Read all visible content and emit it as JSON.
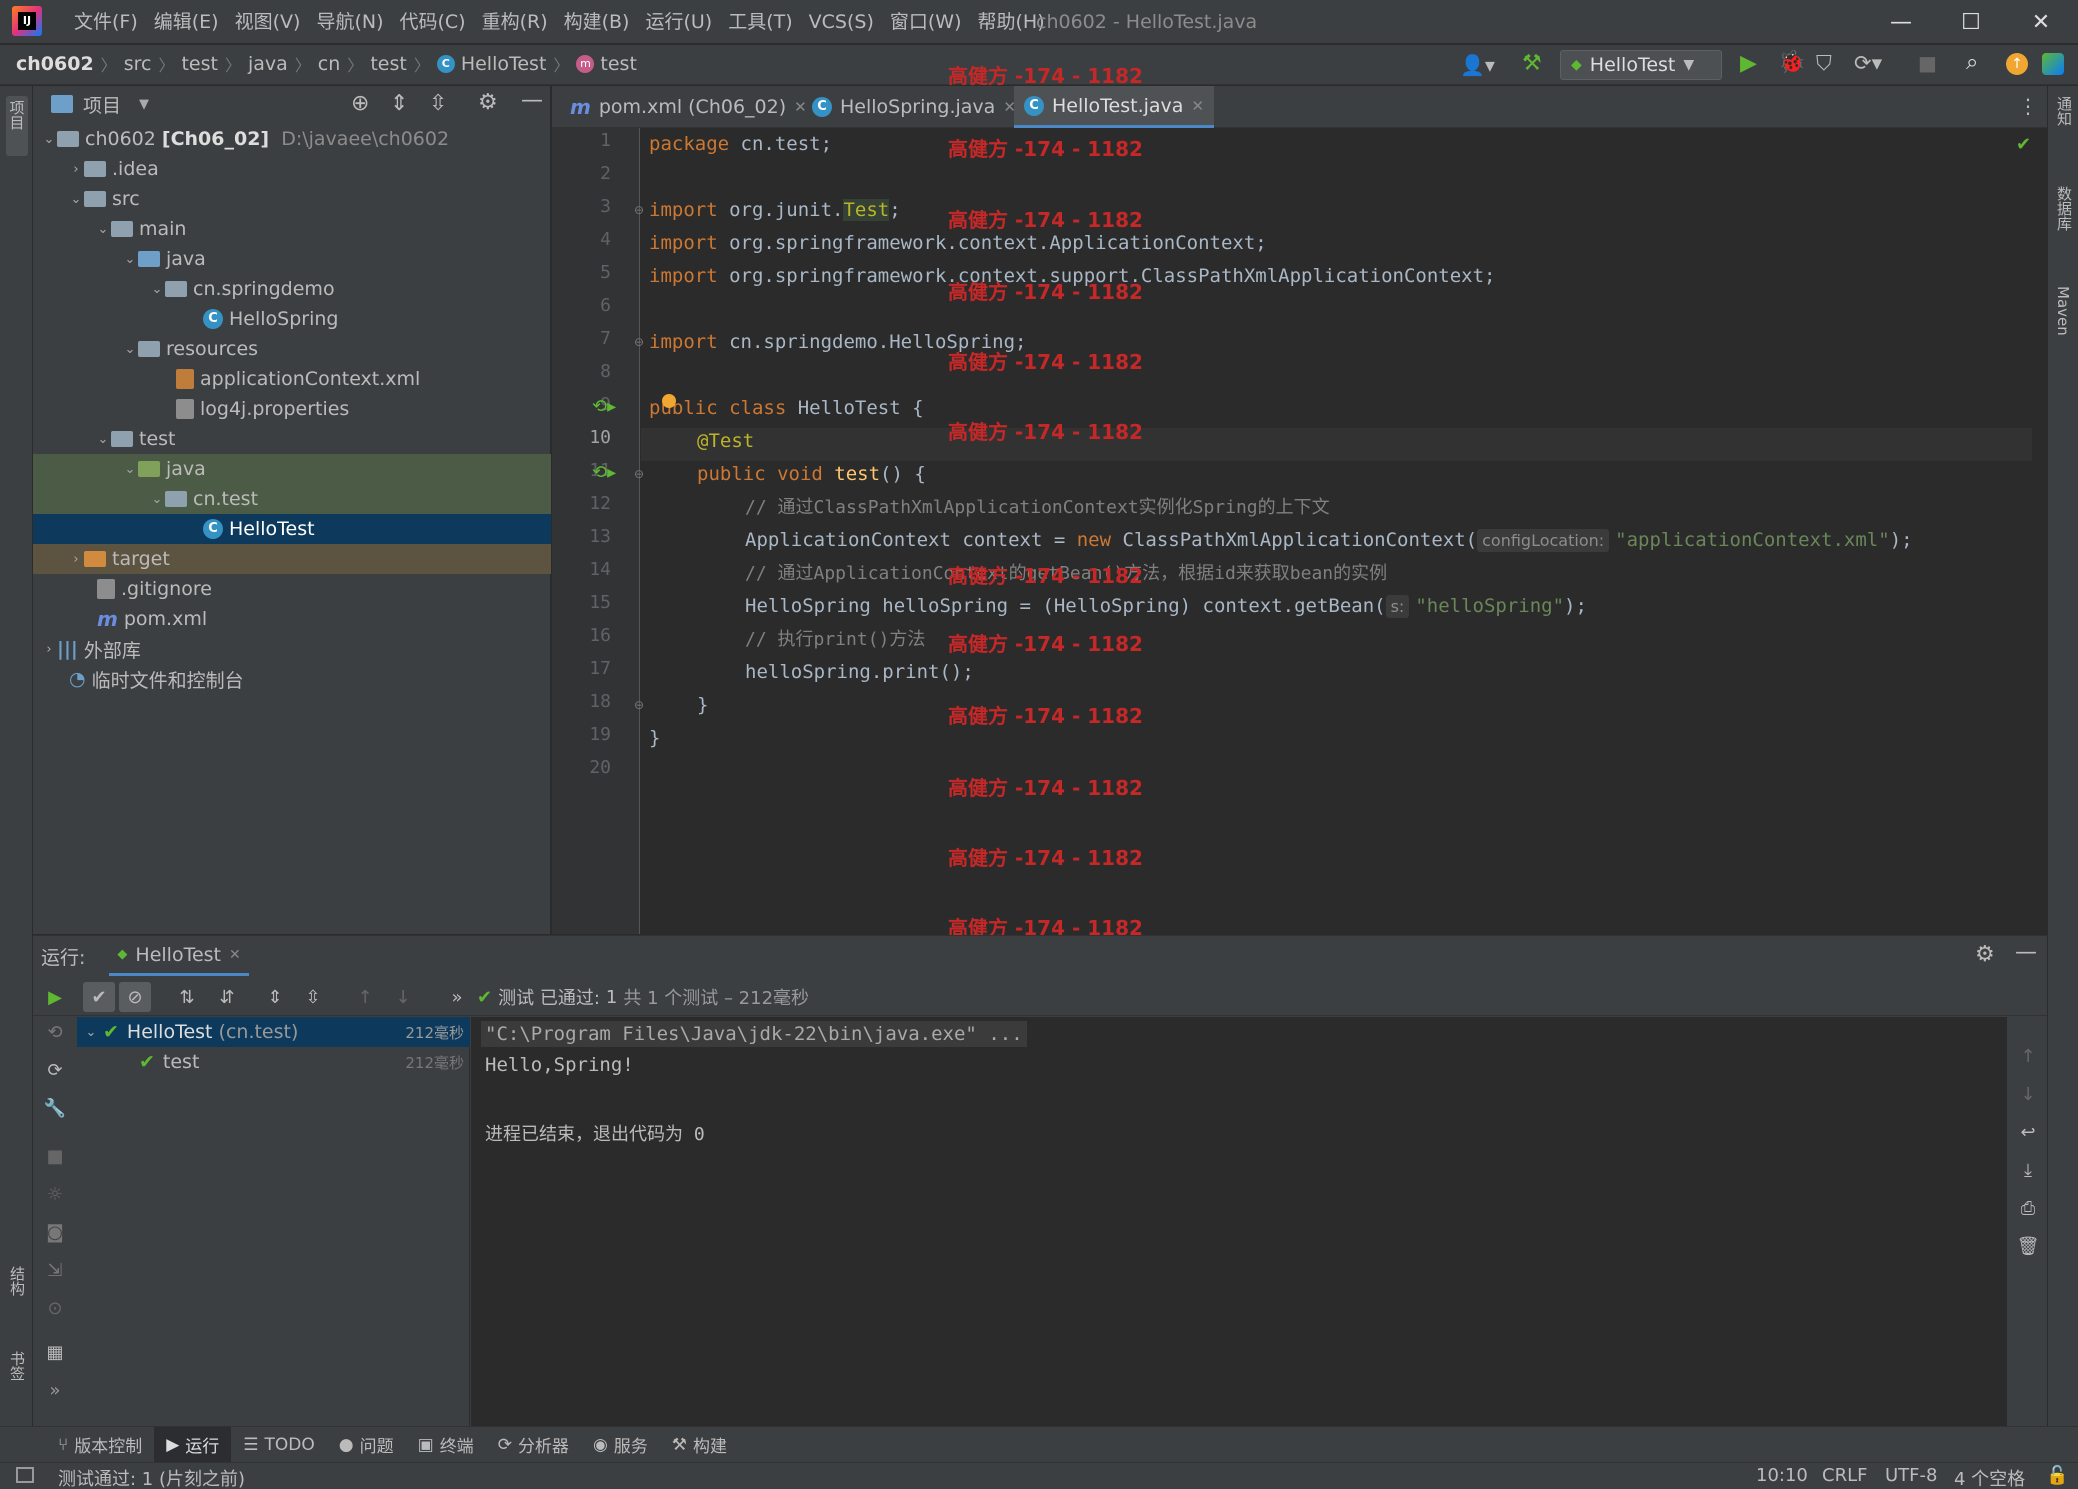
{
  "menu": [
    "文件(F)",
    "编辑(E)",
    "视图(V)",
    "导航(N)",
    "代码(C)",
    "重构(R)",
    "构建(B)",
    "运行(U)",
    "工具(T)",
    "VCS(S)",
    "窗口(W)",
    "帮助(H)"
  ],
  "window_title": "ch0602 - HelloTest.java",
  "breadcrumbs": [
    "ch0602",
    "src",
    "test",
    "java",
    "cn",
    "test",
    "HelloTest",
    "test"
  ],
  "run_config": "HelloTest",
  "left_stripe": {
    "project": "项目",
    "structure": "结构",
    "bookmarks": "书签"
  },
  "right_stripe": {
    "notifications": "通知",
    "database": "数据库",
    "maven": "Maven"
  },
  "project_panel": {
    "title": "项目",
    "tree": [
      {
        "label": "ch0602",
        "bold": "[Ch06_02]",
        "path": "D:\\javaee\\ch0602"
      },
      {
        "label": ".idea"
      },
      {
        "label": "src"
      },
      {
        "label": "main"
      },
      {
        "label": "java"
      },
      {
        "label": "cn.springdemo"
      },
      {
        "label": "HelloSpring"
      },
      {
        "label": "resources"
      },
      {
        "label": "applicationContext.xml"
      },
      {
        "label": "log4j.properties"
      },
      {
        "label": "test"
      },
      {
        "label": "java"
      },
      {
        "label": "cn.test"
      },
      {
        "label": "HelloTest"
      },
      {
        "label": "target"
      },
      {
        "label": ".gitignore"
      },
      {
        "label": "pom.xml"
      },
      {
        "label": "外部库"
      },
      {
        "label": "临时文件和控制台"
      }
    ]
  },
  "tabs": [
    {
      "label": "pom.xml (Ch06_02)"
    },
    {
      "label": "HelloSpring.java"
    },
    {
      "label": "HelloTest.java"
    }
  ],
  "line_numbers": [
    "1",
    "2",
    "3",
    "4",
    "5",
    "6",
    "7",
    "8",
    "9",
    "10",
    "11",
    "12",
    "13",
    "14",
    "15",
    "16",
    "17",
    "18",
    "19",
    "20"
  ],
  "code": {
    "l1_kw": "package",
    "l1_rest": " cn.test;",
    "l3_kw": "import",
    "l3_rest": " org.junit.",
    "l3_hl": "Test",
    "l3_end": ";",
    "l4_kw": "import",
    "l4_rest": " org.springframework.context.ApplicationContext;",
    "l5_kw": "import",
    "l5_rest": " org.springframework.context.support.ClassPathXmlApplicationContext;",
    "l7_kw": "import",
    "l7_rest": " cn.springdemo.HelloSpring;",
    "l9_kw": "public class",
    "l9_rest": " HelloTest {",
    "l10_ann": "@Test",
    "l11_kw": "public void",
    "l11_fn": " test",
    "l11_rest": "() {",
    "l12_cm": "// 通过ClassPathXmlApplicationContext实例化Spring的上下文",
    "l13_a": "ApplicationContext context = ",
    "l13_kw": "new",
    "l13_b": " ClassPathXmlApplicationContext(",
    "l13_hint": "configLocation:",
    "l13_str": "\"applicationContext.xml\"",
    "l13_end": ");",
    "l14_cm": "// 通过ApplicationContext的getBean()方法，根据id来获取bean的实例",
    "l15_a": "HelloSpring helloSpring = (HelloSpring) context.getBean(",
    "l15_hint": "s:",
    "l15_str": "\"helloSpring\"",
    "l15_end": ");",
    "l16_cm": "// 执行print()方法",
    "l17": "helloSpring.print();",
    "l18": "}",
    "l19": "}"
  },
  "watermark": "高健方 -174 - 1182",
  "run_panel": {
    "label": "运行:",
    "tab": "HelloTest",
    "status_prefix": "测试 已通过:",
    "status_count": "1",
    "status_suffix": "共 1 个测试 – 212毫秒",
    "tree": [
      {
        "label": "HelloTest",
        "sub": "(cn.test)",
        "time": "212毫秒"
      },
      {
        "label": "test",
        "time": "212毫秒"
      }
    ],
    "console": [
      "\"C:\\Program Files\\Java\\jdk-22\\bin\\java.exe\" ...",
      "Hello,Spring!",
      "",
      "进程已结束，退出代码为 0"
    ]
  },
  "tool_windows": [
    {
      "label": "版本控制"
    },
    {
      "label": "运行"
    },
    {
      "label": "TODO"
    },
    {
      "label": "问题"
    },
    {
      "label": "终端"
    },
    {
      "label": "分析器"
    },
    {
      "label": "服务"
    },
    {
      "label": "构建"
    }
  ],
  "status_bar": {
    "message": "测试通过: 1 (片刻之前)",
    "position": "10:10",
    "line_sep": "CRLF",
    "encoding": "UTF-8",
    "indent": "4 个空格"
  }
}
